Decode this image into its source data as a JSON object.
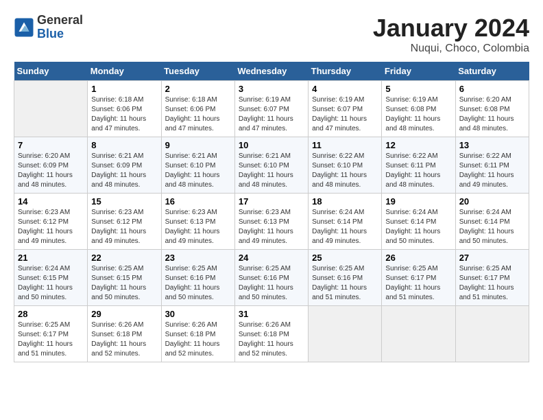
{
  "header": {
    "logo_line1": "General",
    "logo_line2": "Blue",
    "month_year": "January 2024",
    "location": "Nuqui, Choco, Colombia"
  },
  "days_of_week": [
    "Sunday",
    "Monday",
    "Tuesday",
    "Wednesday",
    "Thursday",
    "Friday",
    "Saturday"
  ],
  "weeks": [
    [
      {
        "day": "",
        "empty": true
      },
      {
        "day": "1",
        "sunrise": "6:18 AM",
        "sunset": "6:06 PM",
        "daylight": "11 hours and 47 minutes."
      },
      {
        "day": "2",
        "sunrise": "6:18 AM",
        "sunset": "6:06 PM",
        "daylight": "11 hours and 47 minutes."
      },
      {
        "day": "3",
        "sunrise": "6:19 AM",
        "sunset": "6:07 PM",
        "daylight": "11 hours and 47 minutes."
      },
      {
        "day": "4",
        "sunrise": "6:19 AM",
        "sunset": "6:07 PM",
        "daylight": "11 hours and 47 minutes."
      },
      {
        "day": "5",
        "sunrise": "6:19 AM",
        "sunset": "6:08 PM",
        "daylight": "11 hours and 48 minutes."
      },
      {
        "day": "6",
        "sunrise": "6:20 AM",
        "sunset": "6:08 PM",
        "daylight": "11 hours and 48 minutes."
      }
    ],
    [
      {
        "day": "7",
        "sunrise": "6:20 AM",
        "sunset": "6:09 PM",
        "daylight": "11 hours and 48 minutes."
      },
      {
        "day": "8",
        "sunrise": "6:21 AM",
        "sunset": "6:09 PM",
        "daylight": "11 hours and 48 minutes."
      },
      {
        "day": "9",
        "sunrise": "6:21 AM",
        "sunset": "6:10 PM",
        "daylight": "11 hours and 48 minutes."
      },
      {
        "day": "10",
        "sunrise": "6:21 AM",
        "sunset": "6:10 PM",
        "daylight": "11 hours and 48 minutes."
      },
      {
        "day": "11",
        "sunrise": "6:22 AM",
        "sunset": "6:10 PM",
        "daylight": "11 hours and 48 minutes."
      },
      {
        "day": "12",
        "sunrise": "6:22 AM",
        "sunset": "6:11 PM",
        "daylight": "11 hours and 48 minutes."
      },
      {
        "day": "13",
        "sunrise": "6:22 AM",
        "sunset": "6:11 PM",
        "daylight": "11 hours and 49 minutes."
      }
    ],
    [
      {
        "day": "14",
        "sunrise": "6:23 AM",
        "sunset": "6:12 PM",
        "daylight": "11 hours and 49 minutes."
      },
      {
        "day": "15",
        "sunrise": "6:23 AM",
        "sunset": "6:12 PM",
        "daylight": "11 hours and 49 minutes."
      },
      {
        "day": "16",
        "sunrise": "6:23 AM",
        "sunset": "6:13 PM",
        "daylight": "11 hours and 49 minutes."
      },
      {
        "day": "17",
        "sunrise": "6:23 AM",
        "sunset": "6:13 PM",
        "daylight": "11 hours and 49 minutes."
      },
      {
        "day": "18",
        "sunrise": "6:24 AM",
        "sunset": "6:14 PM",
        "daylight": "11 hours and 49 minutes."
      },
      {
        "day": "19",
        "sunrise": "6:24 AM",
        "sunset": "6:14 PM",
        "daylight": "11 hours and 50 minutes."
      },
      {
        "day": "20",
        "sunrise": "6:24 AM",
        "sunset": "6:14 PM",
        "daylight": "11 hours and 50 minutes."
      }
    ],
    [
      {
        "day": "21",
        "sunrise": "6:24 AM",
        "sunset": "6:15 PM",
        "daylight": "11 hours and 50 minutes."
      },
      {
        "day": "22",
        "sunrise": "6:25 AM",
        "sunset": "6:15 PM",
        "daylight": "11 hours and 50 minutes."
      },
      {
        "day": "23",
        "sunrise": "6:25 AM",
        "sunset": "6:16 PM",
        "daylight": "11 hours and 50 minutes."
      },
      {
        "day": "24",
        "sunrise": "6:25 AM",
        "sunset": "6:16 PM",
        "daylight": "11 hours and 50 minutes."
      },
      {
        "day": "25",
        "sunrise": "6:25 AM",
        "sunset": "6:16 PM",
        "daylight": "11 hours and 51 minutes."
      },
      {
        "day": "26",
        "sunrise": "6:25 AM",
        "sunset": "6:17 PM",
        "daylight": "11 hours and 51 minutes."
      },
      {
        "day": "27",
        "sunrise": "6:25 AM",
        "sunset": "6:17 PM",
        "daylight": "11 hours and 51 minutes."
      }
    ],
    [
      {
        "day": "28",
        "sunrise": "6:25 AM",
        "sunset": "6:17 PM",
        "daylight": "11 hours and 51 minutes."
      },
      {
        "day": "29",
        "sunrise": "6:26 AM",
        "sunset": "6:18 PM",
        "daylight": "11 hours and 52 minutes."
      },
      {
        "day": "30",
        "sunrise": "6:26 AM",
        "sunset": "6:18 PM",
        "daylight": "11 hours and 52 minutes."
      },
      {
        "day": "31",
        "sunrise": "6:26 AM",
        "sunset": "6:18 PM",
        "daylight": "11 hours and 52 minutes."
      },
      {
        "day": "",
        "empty": true
      },
      {
        "day": "",
        "empty": true
      },
      {
        "day": "",
        "empty": true
      }
    ]
  ]
}
